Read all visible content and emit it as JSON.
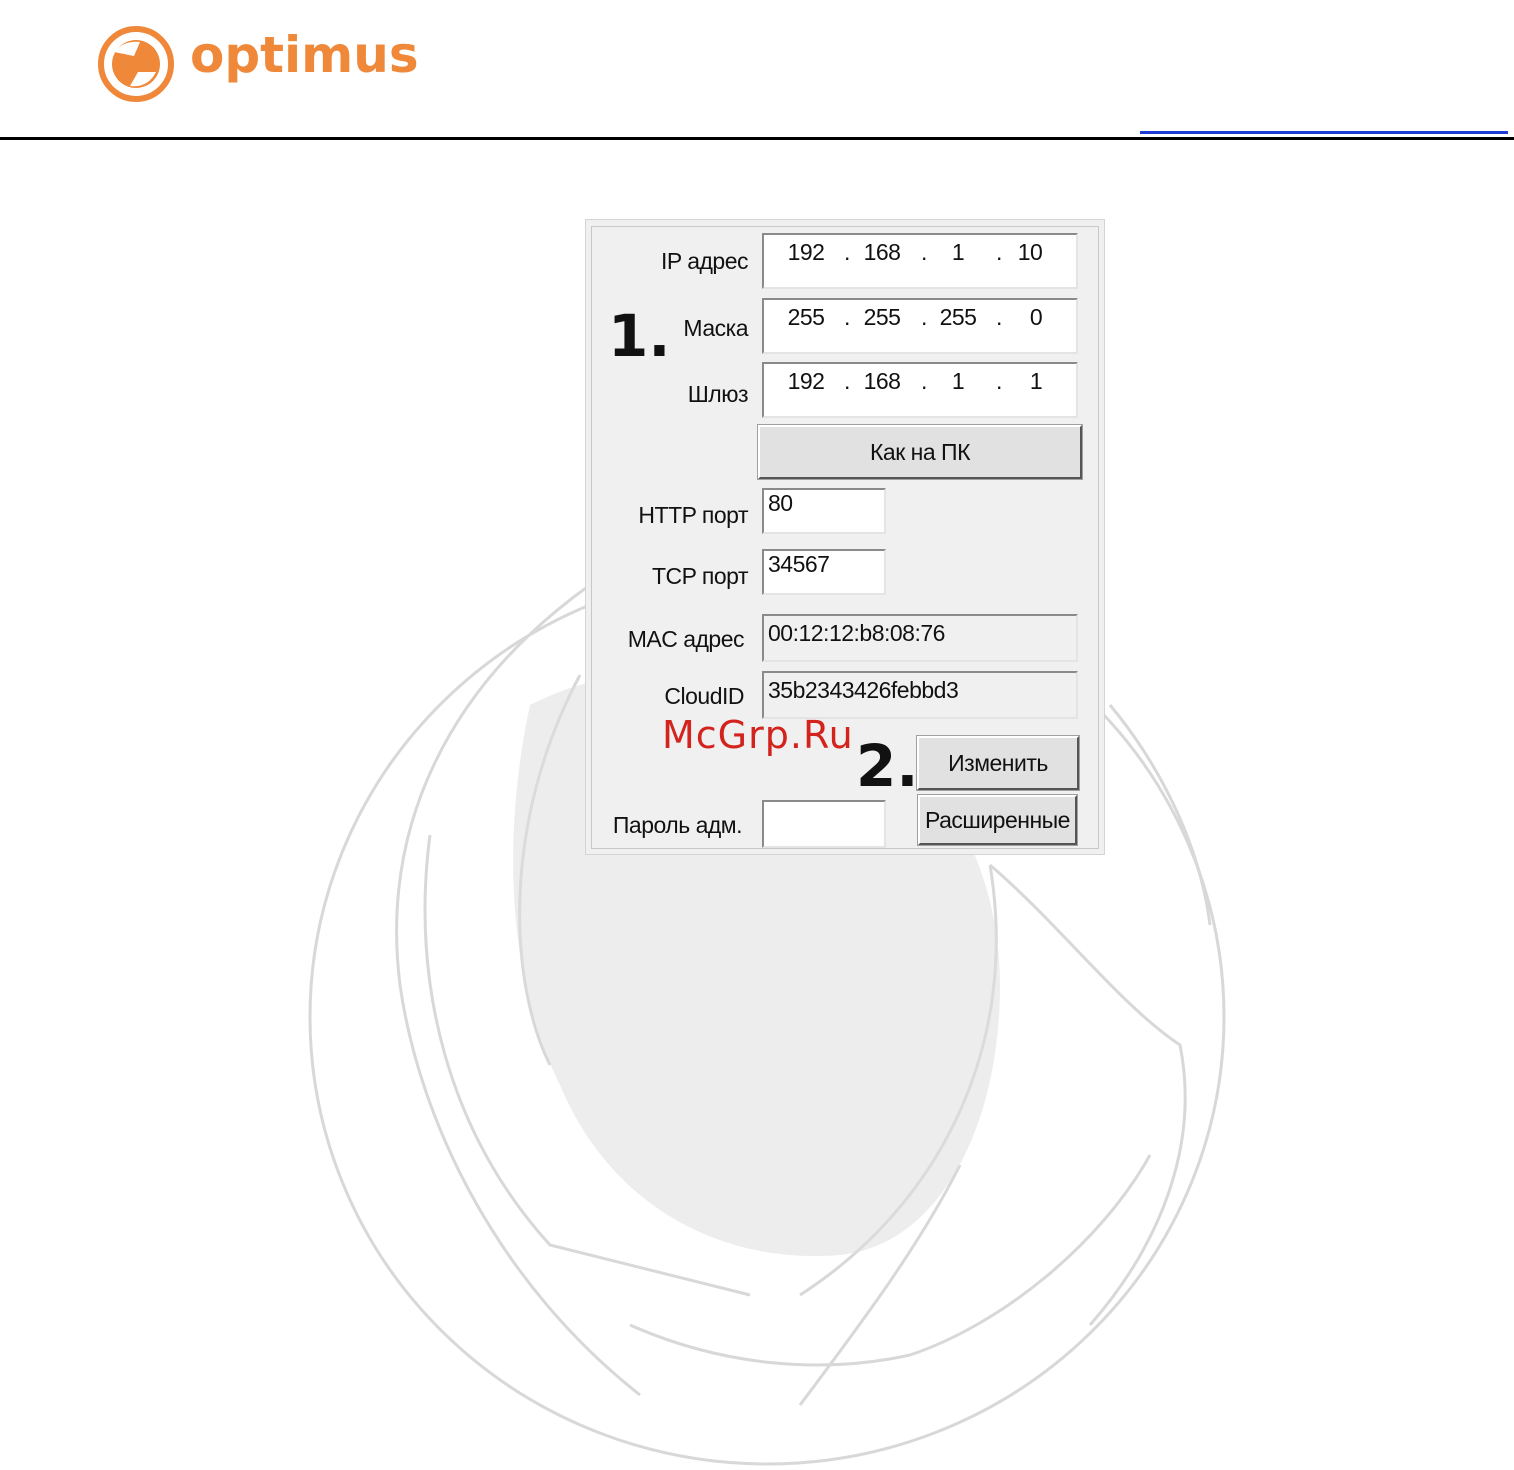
{
  "brand": {
    "name": "optimus",
    "color": "#f0883a"
  },
  "dialog": {
    "ip": {
      "label": "IP адрес",
      "octets": [
        "192",
        "168",
        "1",
        "10"
      ]
    },
    "mask": {
      "label": "Маска",
      "octets": [
        "255",
        "255",
        "255",
        "0"
      ]
    },
    "gateway": {
      "label": "Шлюз",
      "octets": [
        "192",
        "168",
        "1",
        "1"
      ]
    },
    "same_as_pc_label": "Как на ПК",
    "http_port": {
      "label": "HTTP порт",
      "value": "80"
    },
    "tcp_port": {
      "label": "TCP порт",
      "value": "34567"
    },
    "mac": {
      "label": "MAC адрес",
      "value": "00:12:12:b8:08:76"
    },
    "cloud_id": {
      "label": "CloudID",
      "value": "35b2343426febbd3"
    },
    "change_label": "Изменить",
    "password": {
      "label": "Пароль адм.",
      "value": ""
    },
    "advanced_label": "Расширенные"
  },
  "annotations": {
    "step1": "1.",
    "step2": "2."
  },
  "watermark_text": "McGrp.Ru",
  "colors": {
    "header_rule": "#000000",
    "link_rule": "#1f3cd6",
    "watermark": "#d3231d"
  }
}
